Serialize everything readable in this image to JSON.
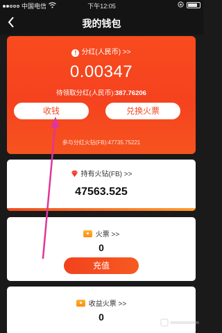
{
  "status_bar": {
    "carrier": "中国电信",
    "time": "下午12:05"
  },
  "nav": {
    "title": "我的钱包"
  },
  "dividend": {
    "label": "分红(人民币) >>",
    "amount": "0.00347",
    "pending_label": "待领取分红(人民币):",
    "pending_value": "387.76206",
    "collect_label": "收钱",
    "exchange_label": "兑换火票",
    "participating_label": "参与分红火钻(FB):47735.75221"
  },
  "diamonds": {
    "label": "持有火钻(FB) >>",
    "value": "47563.525"
  },
  "tickets": {
    "label": "火票 >>",
    "value": "0",
    "recharge_label": "充值"
  },
  "income_tickets": {
    "label": "收益火票 >>",
    "value": "0"
  },
  "colors": {
    "accent": "#f4491f",
    "dark_bg": "#1a1a1a",
    "annotation_arrow": "#e0359a"
  },
  "icons": {
    "back": "chevron-left-icon",
    "info": "info-icon",
    "diamond": "diamond-icon",
    "ticket": "ticket-icon"
  }
}
